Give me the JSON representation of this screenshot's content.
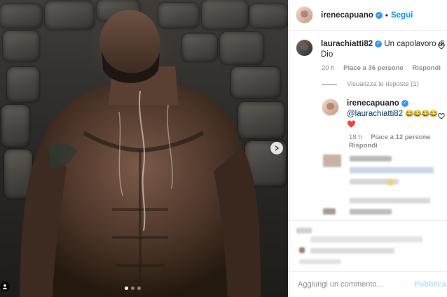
{
  "post": {
    "author": "irenecapuano",
    "verified_icon": "verified-badge-icon",
    "separator": "•",
    "follow_label": "Segui",
    "carousel": {
      "slides": 3,
      "active": 1
    }
  },
  "comments": [
    {
      "user": "laurachiatti82",
      "text_line1": "Un capolavoro di",
      "text_line2": "Dio",
      "time": "20 h",
      "likes": "Piace a 36 persone",
      "reply": "Rispondi"
    }
  ],
  "replies": {
    "toggle_label": "Visualizza le risposte (1)",
    "items": [
      {
        "user": "irenecapuano",
        "mention": "@laurachiatti82",
        "emoji": "😂😂😂😂",
        "emoji2": "❤️",
        "time": "18 h",
        "likes": "Piace a 12 persone",
        "reply": "Rispondi"
      }
    ]
  },
  "composer": {
    "placeholder": "Aggiungi un commento...",
    "publish_label": "Pubblica"
  },
  "colors": {
    "link_blue": "#0095f6",
    "muted": "#8e8e8e",
    "verified_blue": "#3897f0"
  }
}
